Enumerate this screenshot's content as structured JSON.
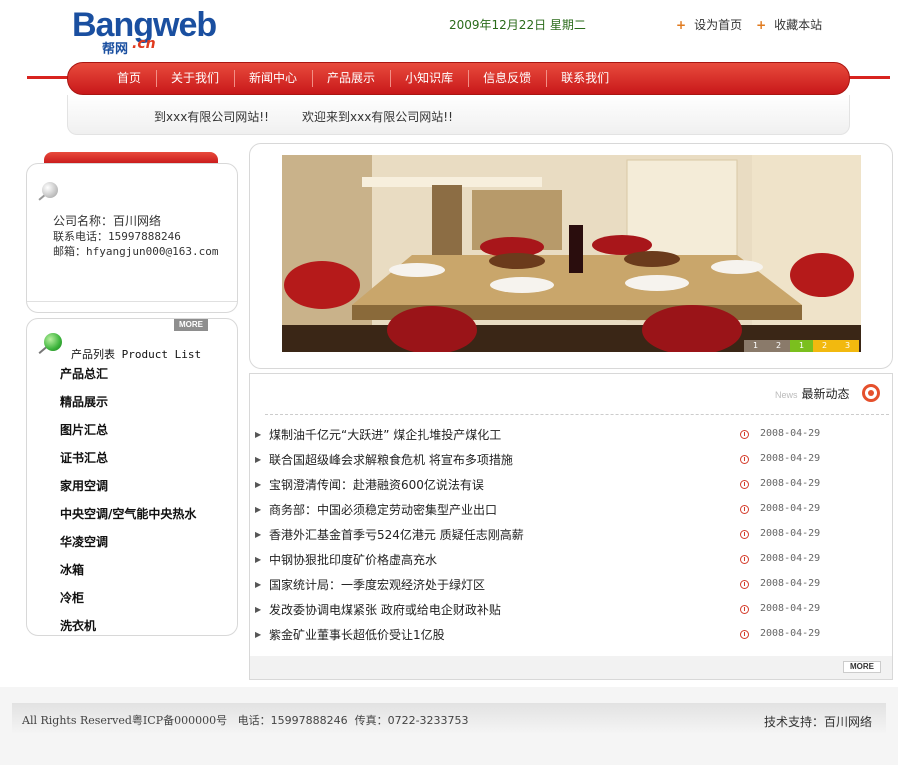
{
  "header": {
    "logo_text": "Bangweb",
    "logo_sub": "帮网",
    "logo_domain": ".cn",
    "date": "2009年12月22日 星期二",
    "top_links": [
      {
        "label": "设为首页"
      },
      {
        "label": "收藏本站"
      }
    ]
  },
  "nav": {
    "items": [
      {
        "label": "首页"
      },
      {
        "label": "关于我们"
      },
      {
        "label": "新闻中心"
      },
      {
        "label": "产品展示"
      },
      {
        "label": "小知识库"
      },
      {
        "label": "信息反馈"
      },
      {
        "label": "联系我们"
      }
    ],
    "marquee": [
      "到xxx有限公司网站!!",
      "欢迎来到xxx有限公司网站!!"
    ]
  },
  "company": {
    "name_line": "公司名称：百川网络",
    "phone_line": "联系电话：15997888246",
    "email_line": "邮箱：hfyangjun000@163.com"
  },
  "products": {
    "more_label": "MORE",
    "title_cn": "产品列表",
    "title_en": "Product List",
    "items": [
      {
        "label": "产品总汇"
      },
      {
        "label": "精品展示"
      },
      {
        "label": "图片汇总"
      },
      {
        "label": "证书汇总"
      },
      {
        "label": "家用空调"
      },
      {
        "label": "中央空调/空气能中央热水"
      },
      {
        "label": "华凌空调"
      },
      {
        "label": "冰箱"
      },
      {
        "label": "冷柜"
      },
      {
        "label": "洗衣机"
      }
    ]
  },
  "banner": {
    "slides": [
      "1",
      "2",
      "1",
      "2",
      "3"
    ],
    "active_index": 2
  },
  "news": {
    "label_en": "News",
    "label_cn": "最新动态",
    "more_label": "MORE",
    "items": [
      {
        "title": "煤制油千亿元“大跃进” 煤企扎堆投产煤化工",
        "date": "2008-04-29"
      },
      {
        "title": "联合国超级峰会求解粮食危机 将宣布多项措施",
        "date": "2008-04-29"
      },
      {
        "title": "宝钢澄清传闻：赴港融资600亿说法有误",
        "date": "2008-04-29"
      },
      {
        "title": "商务部：中国必须稳定劳动密集型产业出口",
        "date": "2008-04-29"
      },
      {
        "title": "香港外汇基金首季亏524亿港元 质疑任志刚高薪",
        "date": "2008-04-29"
      },
      {
        "title": "中钢协狠批印度矿价格虚高充水",
        "date": "2008-04-29"
      },
      {
        "title": "国家统计局：一季度宏观经济处于绿灯区",
        "date": "2008-04-29"
      },
      {
        "title": "发改委协调电煤紧张 政府或给电企财政补贴",
        "date": "2008-04-29"
      },
      {
        "title": "紫金矿业董事长超低价受让1亿股",
        "date": "2008-04-29"
      }
    ]
  },
  "footer": {
    "copyright": "All Rights Reserved粤ICP备000000号",
    "phone": "电话：15997888246",
    "fax": "传真：0722-3233753",
    "support": "技术支持：百川网络"
  },
  "colors": {
    "accent_red": "#d8231f",
    "date_green": "#2a6b1a",
    "logo_blue": "#1a4fa0"
  }
}
